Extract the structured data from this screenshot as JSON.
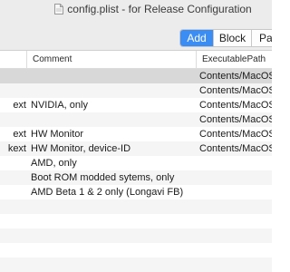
{
  "window": {
    "title": "config.plist - for Release Configuration"
  },
  "toolbar": {
    "buttons": [
      {
        "label": "Add",
        "active": true
      },
      {
        "label": "Block",
        "active": false
      },
      {
        "label": "Pa",
        "active": false
      }
    ]
  },
  "table": {
    "columns": [
      "",
      "Comment",
      "ExecutablePath"
    ],
    "rows": [
      {
        "name": "",
        "comment": "",
        "path": "Contents/MacOS",
        "style": "sel"
      },
      {
        "name": "",
        "comment": "",
        "path": "Contents/MacOS",
        "style": "alt"
      },
      {
        "name": "ext",
        "comment": "NVIDIA, only",
        "path": "Contents/MacOS",
        "style": ""
      },
      {
        "name": "",
        "comment": "",
        "path": "Contents/MacOS",
        "style": "alt"
      },
      {
        "name": "ext",
        "comment": "HW Monitor",
        "path": "Contents/MacOS",
        "style": ""
      },
      {
        "name": "kext",
        "comment": "HW Monitor, device-ID",
        "path": "Contents/MacOS",
        "style": "alt"
      },
      {
        "name": "",
        "comment": "AMD, only",
        "path": "",
        "style": ""
      },
      {
        "name": "",
        "comment": "Boot ROM modded sytems, only",
        "path": "",
        "style": "alt"
      },
      {
        "name": "",
        "comment": "AMD Beta 1 & 2 only (Longavi FB)",
        "path": "",
        "style": ""
      },
      {
        "name": "",
        "comment": "",
        "path": "",
        "style": "alt"
      },
      {
        "name": "",
        "comment": "",
        "path": "",
        "style": ""
      },
      {
        "name": "",
        "comment": "",
        "path": "",
        "style": "alt"
      },
      {
        "name": "",
        "comment": "",
        "path": "",
        "style": ""
      },
      {
        "name": "",
        "comment": "",
        "path": "",
        "style": "alt"
      }
    ]
  }
}
